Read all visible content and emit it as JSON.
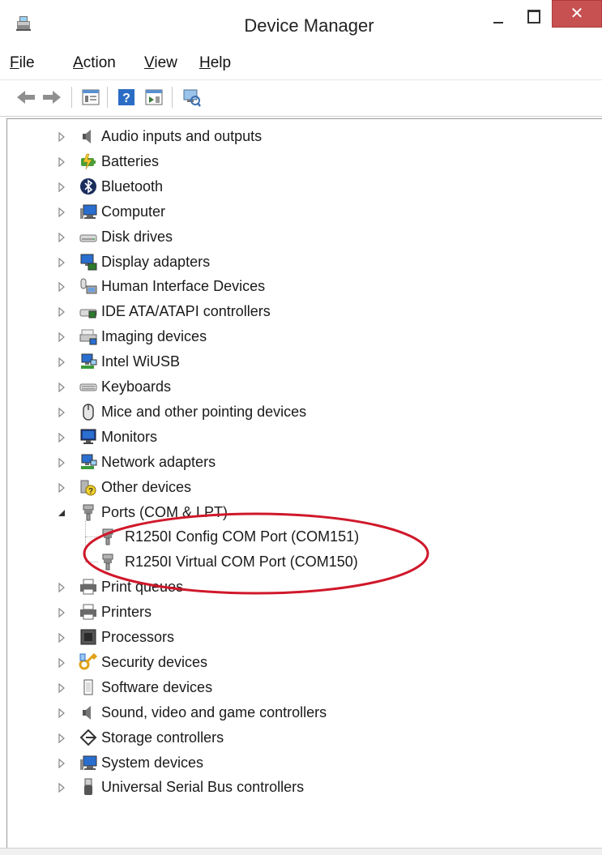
{
  "window": {
    "title": "Device Manager",
    "close_glyph": "✕",
    "app_icon": "device-manager-icon"
  },
  "menu": [
    {
      "label": "File",
      "key": "F",
      "rest": "ile"
    },
    {
      "label": "Action",
      "key": "A",
      "rest": "ction"
    },
    {
      "label": "View",
      "key": "V",
      "rest": "iew"
    },
    {
      "label": "Help",
      "key": "H",
      "rest": "elp"
    }
  ],
  "toolbar": {
    "buttons": [
      "back-icon",
      "forward-icon",
      "properties-icon",
      "help-icon",
      "show-hidden-icon",
      "scan-hardware-icon"
    ]
  },
  "tree": {
    "categories": [
      {
        "label": "Audio inputs and outputs",
        "icon": "speaker-icon",
        "expanded": false
      },
      {
        "label": "Batteries",
        "icon": "battery-icon",
        "expanded": false
      },
      {
        "label": "Bluetooth",
        "icon": "bluetooth-icon",
        "expanded": false
      },
      {
        "label": "Computer",
        "icon": "computer-icon",
        "expanded": false
      },
      {
        "label": "Disk drives",
        "icon": "disk-drive-icon",
        "expanded": false
      },
      {
        "label": "Display adapters",
        "icon": "display-adapter-icon",
        "expanded": false
      },
      {
        "label": "Human Interface Devices",
        "icon": "hid-icon",
        "expanded": false
      },
      {
        "label": "IDE ATA/ATAPI controllers",
        "icon": "ide-controller-icon",
        "expanded": false
      },
      {
        "label": "Imaging devices",
        "icon": "scanner-icon",
        "expanded": false
      },
      {
        "label": "Intel WiUSB",
        "icon": "network-icon",
        "expanded": false
      },
      {
        "label": "Keyboards",
        "icon": "keyboard-icon",
        "expanded": false
      },
      {
        "label": "Mice and other pointing devices",
        "icon": "mouse-icon",
        "expanded": false
      },
      {
        "label": "Monitors",
        "icon": "monitor-icon",
        "expanded": false
      },
      {
        "label": "Network adapters",
        "icon": "network-icon",
        "expanded": false
      },
      {
        "label": "Other devices",
        "icon": "unknown-device-icon",
        "expanded": false
      },
      {
        "label": "Ports (COM & LPT)",
        "icon": "port-icon",
        "expanded": true,
        "children": [
          {
            "label": "R1250I Config COM Port (COM151)",
            "icon": "port-icon"
          },
          {
            "label": "R1250I Virtual COM Port (COM150)",
            "icon": "port-icon"
          }
        ]
      },
      {
        "label": "Print queues",
        "icon": "printer-icon",
        "expanded": false
      },
      {
        "label": "Printers",
        "icon": "printer-icon",
        "expanded": false
      },
      {
        "label": "Processors",
        "icon": "processor-icon",
        "expanded": false
      },
      {
        "label": "Security devices",
        "icon": "key-icon",
        "expanded": false
      },
      {
        "label": "Software devices",
        "icon": "software-device-icon",
        "expanded": false
      },
      {
        "label": "Sound, video and game controllers",
        "icon": "speaker-icon",
        "expanded": false
      },
      {
        "label": "Storage controllers",
        "icon": "storage-controller-icon",
        "expanded": false
      },
      {
        "label": "System devices",
        "icon": "computer-icon",
        "expanded": false
      },
      {
        "label": "Universal Serial Bus controllers",
        "icon": "usb-icon",
        "expanded": false
      }
    ]
  },
  "colors": {
    "close_button": "#c75050",
    "highlight_ellipse": "#d0182a"
  }
}
